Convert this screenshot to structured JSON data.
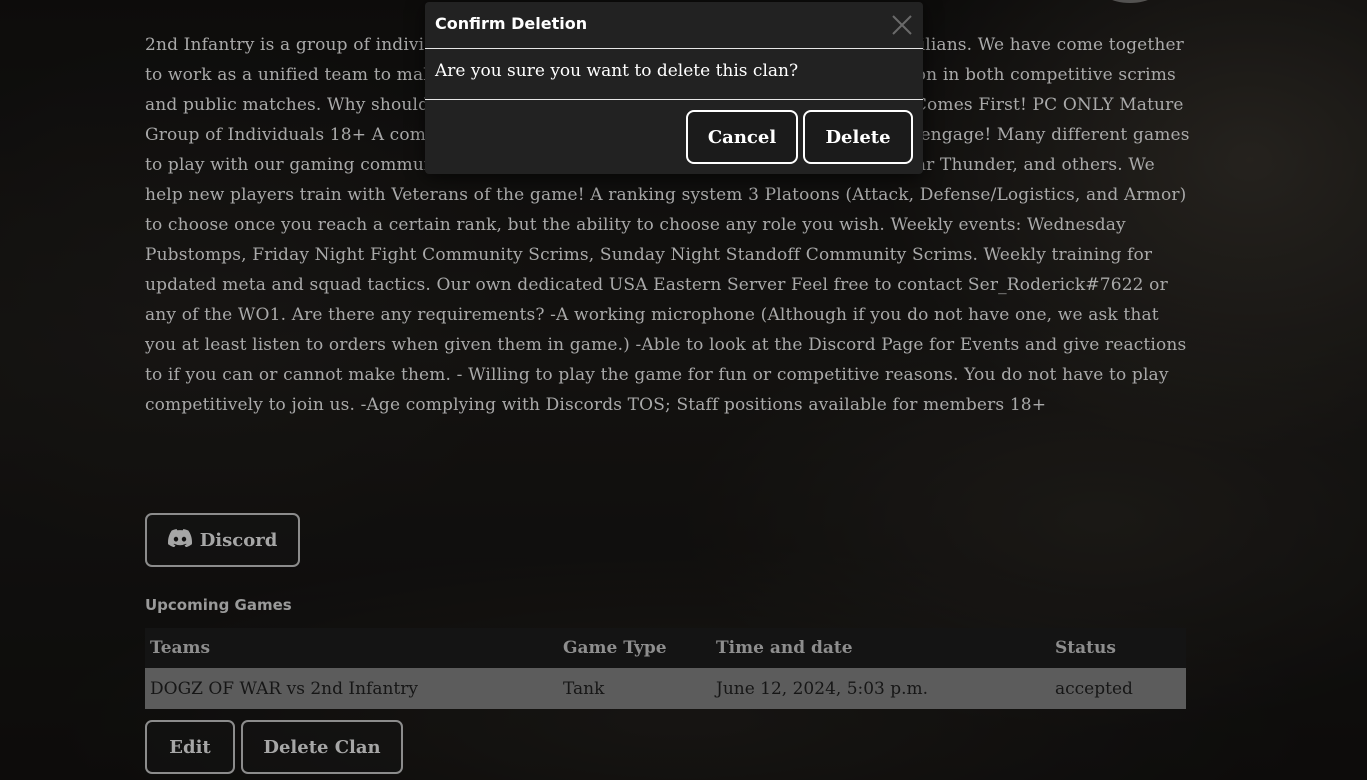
{
  "clan": {
    "description": "2nd Infantry is a group of individuals from all walks of life, veterans, active duty and civilians. We have come together to work as a unified team to make ourselves known as a competitive and effective division in both competitive scrims and public matches. Why should you join a community with the 2nd Infantry? Real Life Comes First! PC ONLY Mature Group of Individuals 18+ A community that is super chill. Players who actually talk and engage! Many different games to play with our gaming community with; HLL, Jackbox, Escape from Tarkov, Arma 3, War Thunder, and others. We help new players train with Veterans of the game! A ranking system 3 Platoons (Attack, Defense/Logistics, and Armor) to choose once you reach a certain rank, but the ability to choose any role you wish. Weekly events: Wednesday Pubstomps, Friday Night Fight Community Scrims, Sunday Night Standoff Community Scrims. Weekly training for updated meta and squad tactics. Our own dedicated USA Eastern Server Feel free to contact Ser_Roderick#7622 or any of the WO1. Are there any requirements? -A working microphone (Although if you do not have one, we ask that you at least listen to orders when given them in game.) -Able to look at the Discord Page for Events and give reactions to if you can or cannot make them. - Willing to play the game for fun or competitive reasons. You do not have to play competitively to join us. -Age complying with Discords TOS; Staff positions available for members 18+",
    "discord_label": "Discord"
  },
  "upcoming": {
    "title": "Upcoming Games",
    "columns": [
      "Teams",
      "Game Type",
      "Time and date",
      "Status"
    ],
    "rows": [
      [
        "DOGZ OF WAR vs 2nd Infantry",
        "Tank",
        "June 12, 2024, 5:03 p.m.",
        "accepted"
      ]
    ]
  },
  "actions": {
    "edit_label": "Edit",
    "delete_clan_label": "Delete Clan"
  },
  "modal": {
    "title": "Confirm Deletion",
    "message": "Are you sure you want to delete this clan?",
    "cancel_label": "Cancel",
    "delete_label": "Delete"
  },
  "icons": {
    "discord": "discord-icon",
    "close": "close-icon"
  },
  "colors": {
    "modal_bg": "#222222",
    "table_row_bg": "#5c5c5c",
    "text_muted": "#a9a9a9"
  }
}
